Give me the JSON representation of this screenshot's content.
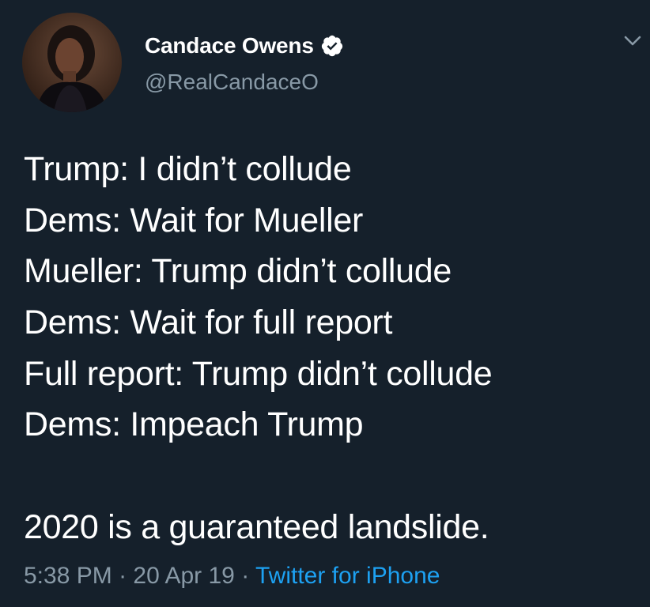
{
  "tweet": {
    "author": {
      "display_name": "Candace Owens",
      "handle": "@RealCandaceO",
      "verified": true,
      "verified_icon": "verified-badge-icon"
    },
    "text_lines": [
      "Trump: I didn’t collude",
      "Dems: Wait for Mueller",
      "Mueller: Trump didn’t collude",
      "Dems: Wait for full report",
      "Full report: Trump didn’t collude",
      "Dems: Impeach Trump",
      "",
      "2020 is a guaranteed landslide."
    ],
    "meta": {
      "time": "5:38 PM",
      "separator": "·",
      "date": "20 Apr 19",
      "source": "Twitter for iPhone"
    },
    "menu_icon": "chevron-down-icon"
  },
  "colors": {
    "background": "#15202b",
    "text": "#ffffff",
    "secondary_text": "#8899a6",
    "link": "#1da1f2"
  }
}
